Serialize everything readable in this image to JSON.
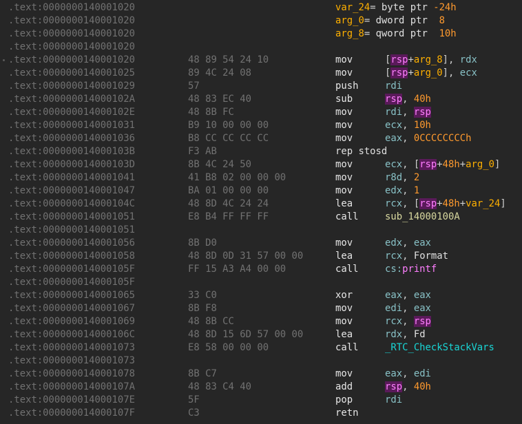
{
  "listing": {
    "rows": [
      {
        "addr": ".text:0000000140001020",
        "bytes": "",
        "mnem": "",
        "tokens": [
          {
            "t": "var_24",
            "c": "var"
          },
          {
            "t": "= ",
            "c": "txt"
          },
          {
            "t": "byte ptr ",
            "c": "kw"
          },
          {
            "t": "-24h",
            "c": "num"
          }
        ],
        "kind": "full"
      },
      {
        "addr": ".text:0000000140001020",
        "bytes": "",
        "mnem": "",
        "tokens": [
          {
            "t": "arg_0",
            "c": "var"
          },
          {
            "t": "= ",
            "c": "txt"
          },
          {
            "t": "dword ptr  ",
            "c": "kw"
          },
          {
            "t": "8",
            "c": "num"
          }
        ],
        "kind": "full"
      },
      {
        "addr": ".text:0000000140001020",
        "bytes": "",
        "mnem": "",
        "tokens": [
          {
            "t": "arg_8",
            "c": "var"
          },
          {
            "t": "= ",
            "c": "txt"
          },
          {
            "t": "qword ptr  ",
            "c": "kw"
          },
          {
            "t": "10h",
            "c": "num"
          }
        ],
        "kind": "full"
      },
      {
        "addr": ".text:0000000140001020",
        "bytes": "",
        "mnem": "",
        "tokens": [],
        "kind": "blank"
      },
      {
        "addr": ".text:0000000140001020",
        "bytes": "48 89 54 24 10",
        "mnem": "mov",
        "tokens": [
          {
            "t": "[",
            "c": "txt"
          },
          {
            "t": "rsp",
            "c": "hl"
          },
          {
            "t": "+",
            "c": "txt"
          },
          {
            "t": "arg_8",
            "c": "var"
          },
          {
            "t": "], ",
            "c": "txt"
          },
          {
            "t": "rdx",
            "c": "reg"
          }
        ],
        "kind": "ins",
        "dot": true
      },
      {
        "addr": ".text:0000000140001025",
        "bytes": "89 4C 24 08",
        "mnem": "mov",
        "tokens": [
          {
            "t": "[",
            "c": "txt"
          },
          {
            "t": "rsp",
            "c": "hl"
          },
          {
            "t": "+",
            "c": "txt"
          },
          {
            "t": "arg_0",
            "c": "var"
          },
          {
            "t": "], ",
            "c": "txt"
          },
          {
            "t": "ecx",
            "c": "reg"
          }
        ],
        "kind": "ins"
      },
      {
        "addr": ".text:0000000140001029",
        "bytes": "57",
        "mnem": "push",
        "tokens": [
          {
            "t": "rdi",
            "c": "reg"
          }
        ],
        "kind": "ins"
      },
      {
        "addr": ".text:000000014000102A",
        "bytes": "48 83 EC 40",
        "mnem": "sub",
        "tokens": [
          {
            "t": "rsp",
            "c": "hl"
          },
          {
            "t": ", ",
            "c": "txt"
          },
          {
            "t": "40h",
            "c": "num"
          }
        ],
        "kind": "ins"
      },
      {
        "addr": ".text:000000014000102E",
        "bytes": "48 8B FC",
        "mnem": "mov",
        "tokens": [
          {
            "t": "rdi",
            "c": "reg"
          },
          {
            "t": ", ",
            "c": "txt"
          },
          {
            "t": "rsp",
            "c": "hl"
          }
        ],
        "kind": "ins"
      },
      {
        "addr": ".text:0000000140001031",
        "bytes": "B9 10 00 00 00",
        "mnem": "mov",
        "tokens": [
          {
            "t": "ecx",
            "c": "reg"
          },
          {
            "t": ", ",
            "c": "txt"
          },
          {
            "t": "10h",
            "c": "num"
          }
        ],
        "kind": "ins"
      },
      {
        "addr": ".text:0000000140001036",
        "bytes": "B8 CC CC CC CC",
        "mnem": "mov",
        "tokens": [
          {
            "t": "eax",
            "c": "reg"
          },
          {
            "t": ", ",
            "c": "txt"
          },
          {
            "t": "0CCCCCCCCh",
            "c": "num"
          }
        ],
        "kind": "ins"
      },
      {
        "addr": ".text:000000014000103B",
        "bytes": "F3 AB",
        "mnem": "",
        "tokens": [
          {
            "t": "rep stosd",
            "c": "kw"
          }
        ],
        "kind": "full"
      },
      {
        "addr": ".text:000000014000103D",
        "bytes": "8B 4C 24 50",
        "mnem": "mov",
        "tokens": [
          {
            "t": "ecx",
            "c": "reg"
          },
          {
            "t": ", [",
            "c": "txt"
          },
          {
            "t": "rsp",
            "c": "hl"
          },
          {
            "t": "+",
            "c": "txt"
          },
          {
            "t": "48h",
            "c": "num"
          },
          {
            "t": "+",
            "c": "txt"
          },
          {
            "t": "arg_0",
            "c": "var"
          },
          {
            "t": "]",
            "c": "txt"
          }
        ],
        "kind": "ins"
      },
      {
        "addr": ".text:0000000140001041",
        "bytes": "41 B8 02 00 00 00",
        "mnem": "mov",
        "tokens": [
          {
            "t": "r8d",
            "c": "reg"
          },
          {
            "t": ", ",
            "c": "txt"
          },
          {
            "t": "2",
            "c": "num"
          }
        ],
        "kind": "ins"
      },
      {
        "addr": ".text:0000000140001047",
        "bytes": "BA 01 00 00 00",
        "mnem": "mov",
        "tokens": [
          {
            "t": "edx",
            "c": "reg"
          },
          {
            "t": ", ",
            "c": "txt"
          },
          {
            "t": "1",
            "c": "num"
          }
        ],
        "kind": "ins"
      },
      {
        "addr": ".text:000000014000104C",
        "bytes": "48 8D 4C 24 24",
        "mnem": "lea",
        "tokens": [
          {
            "t": "rcx",
            "c": "reg"
          },
          {
            "t": ", [",
            "c": "txt"
          },
          {
            "t": "rsp",
            "c": "hl"
          },
          {
            "t": "+",
            "c": "txt"
          },
          {
            "t": "48h",
            "c": "num"
          },
          {
            "t": "+",
            "c": "txt"
          },
          {
            "t": "var_24",
            "c": "var"
          },
          {
            "t": "]",
            "c": "txt"
          }
        ],
        "kind": "ins"
      },
      {
        "addr": ".text:0000000140001051",
        "bytes": "E8 B4 FF FF FF",
        "mnem": "call",
        "tokens": [
          {
            "t": "sub_14000100A",
            "c": "sub"
          }
        ],
        "kind": "ins"
      },
      {
        "addr": ".text:0000000140001051",
        "bytes": "",
        "mnem": "",
        "tokens": [],
        "kind": "blank"
      },
      {
        "addr": ".text:0000000140001056",
        "bytes": "8B D0",
        "mnem": "mov",
        "tokens": [
          {
            "t": "edx",
            "c": "reg"
          },
          {
            "t": ", ",
            "c": "txt"
          },
          {
            "t": "eax",
            "c": "reg"
          }
        ],
        "kind": "ins"
      },
      {
        "addr": ".text:0000000140001058",
        "bytes": "48 8D 0D 31 57 00 00",
        "mnem": "lea",
        "tokens": [
          {
            "t": "rcx",
            "c": "reg"
          },
          {
            "t": ", ",
            "c": "txt"
          },
          {
            "t": "Format",
            "c": "sym"
          }
        ],
        "kind": "ins"
      },
      {
        "addr": ".text:000000014000105F",
        "bytes": "FF 15 A3 A4 00 00",
        "mnem": "call",
        "tokens": [
          {
            "t": "cs:",
            "c": "reg"
          },
          {
            "t": "printf",
            "c": "ext"
          }
        ],
        "kind": "ins"
      },
      {
        "addr": ".text:000000014000105F",
        "bytes": "",
        "mnem": "",
        "tokens": [],
        "kind": "blank"
      },
      {
        "addr": ".text:0000000140001065",
        "bytes": "33 C0",
        "mnem": "xor",
        "tokens": [
          {
            "t": "eax",
            "c": "reg"
          },
          {
            "t": ", ",
            "c": "txt"
          },
          {
            "t": "eax",
            "c": "reg"
          }
        ],
        "kind": "ins"
      },
      {
        "addr": ".text:0000000140001067",
        "bytes": "8B F8",
        "mnem": "mov",
        "tokens": [
          {
            "t": "edi",
            "c": "reg"
          },
          {
            "t": ", ",
            "c": "txt"
          },
          {
            "t": "eax",
            "c": "reg"
          }
        ],
        "kind": "ins"
      },
      {
        "addr": ".text:0000000140001069",
        "bytes": "48 8B CC",
        "mnem": "mov",
        "tokens": [
          {
            "t": "rcx",
            "c": "reg"
          },
          {
            "t": ", ",
            "c": "txt"
          },
          {
            "t": "rsp",
            "c": "hl"
          }
        ],
        "kind": "ins"
      },
      {
        "addr": ".text:000000014000106C",
        "bytes": "48 8D 15 6D 57 00 00",
        "mnem": "lea",
        "tokens": [
          {
            "t": "rdx",
            "c": "reg"
          },
          {
            "t": ", ",
            "c": "txt"
          },
          {
            "t": "Fd",
            "c": "sym"
          }
        ],
        "kind": "ins"
      },
      {
        "addr": ".text:0000000140001073",
        "bytes": "E8 58 00 00 00",
        "mnem": "call",
        "tokens": [
          {
            "t": "_RTC_CheckStackVars",
            "c": "tel"
          }
        ],
        "kind": "ins"
      },
      {
        "addr": ".text:0000000140001073",
        "bytes": "",
        "mnem": "",
        "tokens": [],
        "kind": "blank"
      },
      {
        "addr": ".text:0000000140001078",
        "bytes": "8B C7",
        "mnem": "mov",
        "tokens": [
          {
            "t": "eax",
            "c": "reg"
          },
          {
            "t": ", ",
            "c": "txt"
          },
          {
            "t": "edi",
            "c": "reg"
          }
        ],
        "kind": "ins"
      },
      {
        "addr": ".text:000000014000107A",
        "bytes": "48 83 C4 40",
        "mnem": "add",
        "tokens": [
          {
            "t": "rsp",
            "c": "hl"
          },
          {
            "t": ", ",
            "c": "txt"
          },
          {
            "t": "40h",
            "c": "num"
          }
        ],
        "kind": "ins"
      },
      {
        "addr": ".text:000000014000107E",
        "bytes": "5F",
        "mnem": "pop",
        "tokens": [
          {
            "t": "rdi",
            "c": "reg"
          }
        ],
        "kind": "ins"
      },
      {
        "addr": ".text:000000014000107F",
        "bytes": "C3",
        "mnem": "retn",
        "tokens": [],
        "kind": "ins"
      }
    ]
  },
  "colors": {
    "background": "#262626",
    "address": "#727272",
    "register": "#89c2c7",
    "number": "#ff9a2e",
    "highlight_fg": "#ff7fff",
    "highlight_bg": "#5a1a5a",
    "variable": "#ffb000",
    "teal_call": "#19d6d6"
  }
}
